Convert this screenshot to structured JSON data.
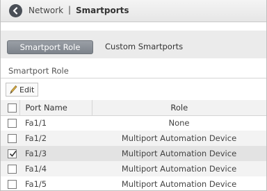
{
  "header": {
    "back_icon": "chevron-left-circle-icon",
    "breadcrumb_parent": "Network",
    "breadcrumb_separator": "|",
    "page_title": "Smartports"
  },
  "tabs": [
    {
      "label": "Smartport Role",
      "active": true
    },
    {
      "label": "Custom Smartports",
      "active": false
    }
  ],
  "section": {
    "title": "Smartport Role"
  },
  "toolbar": {
    "edit_label": "Edit",
    "edit_icon": "pencil-icon"
  },
  "table": {
    "columns": [
      "Port Name",
      "Role"
    ],
    "rows": [
      {
        "port": "Fa1/1",
        "role": "None",
        "checked": false
      },
      {
        "port": "Fa1/2",
        "role": "Multiport Automation Device",
        "checked": false
      },
      {
        "port": "Fa1/3",
        "role": "Multiport Automation Device",
        "checked": true
      },
      {
        "port": "Fa1/4",
        "role": "Multiport Automation Device",
        "checked": false
      },
      {
        "port": "Fa1/5",
        "role": "Multiport Automation Device",
        "checked": false
      }
    ]
  }
}
